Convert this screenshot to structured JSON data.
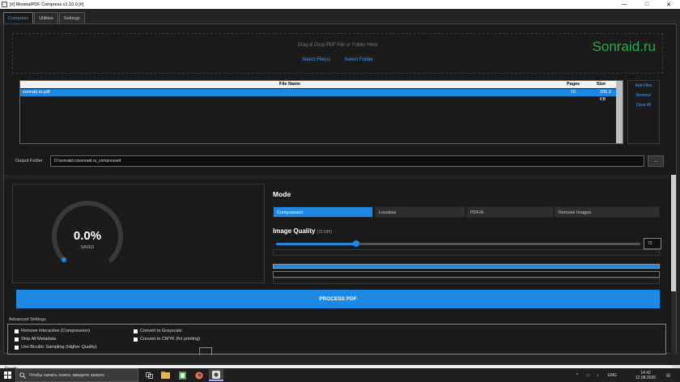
{
  "window": {
    "title": "[#] MinimalPDF Compress v1.10.0 [#]",
    "controls": {
      "minimize": "—",
      "maximize": "□",
      "close": "✕"
    }
  },
  "tabs": [
    {
      "label": "Compress",
      "active": true
    },
    {
      "label": "Utilities",
      "active": false
    },
    {
      "label": "Settings",
      "active": false
    }
  ],
  "dropzone": {
    "hint": "Drag & Drop PDF File or Folder Here",
    "select_files": "Select File(s)",
    "select_folder": "Select Folder",
    "watermark": "Sonraid.ru"
  },
  "file_table": {
    "headers": {
      "name": "File Name",
      "pages": "Pages",
      "size": "Size"
    },
    "rows": [
      {
        "name": "sonraid.ru.pdf",
        "pages": "16",
        "size": "295.3 KB",
        "selected": true
      }
    ]
  },
  "side_actions": {
    "add": "Add Files",
    "remove": "Remove",
    "clear": "Clear All"
  },
  "output": {
    "label": "Output Folder",
    "path": "D:\\sonraid.ru\\sonraid.ru_compressed",
    "browse": "..."
  },
  "stats": {
    "percent": "0.0%",
    "caption": "SAVED",
    "ring_fraction": 0.0
  },
  "mode": {
    "title": "Mode",
    "options": [
      {
        "label": "Compression",
        "active": true
      },
      {
        "label": "Lossless",
        "active": false
      },
      {
        "label": "PDF/A",
        "active": false
      },
      {
        "label": "Remove Images",
        "active": false
      }
    ]
  },
  "image_quality": {
    "title": "Image Quality",
    "dpi_label": "(72 DPI)",
    "value": "72",
    "slider_fraction": 0.22
  },
  "progress": {
    "fraction": 1.0
  },
  "process_button": "PROCESS PDF",
  "advanced": {
    "title": "Advanced Settings",
    "options": [
      {
        "label": "Remove Interactive (Compression)"
      },
      {
        "label": "Strip All Metadata"
      },
      {
        "label": "Use Bicubic Sampling (Higher Quality)"
      },
      {
        "label": "Convert to Grayscale"
      },
      {
        "label": "Convert to CMYK (for printing)"
      }
    ]
  },
  "status": "Ready",
  "taskbar": {
    "search_placeholder": "Чтобы начать поиск, введите запрос",
    "language": "ENG",
    "time": "14:42",
    "date": "12.08.2026"
  },
  "colors": {
    "accent": "#1e88e5",
    "link": "#4a9eff",
    "watermark": "#2ea84b"
  }
}
